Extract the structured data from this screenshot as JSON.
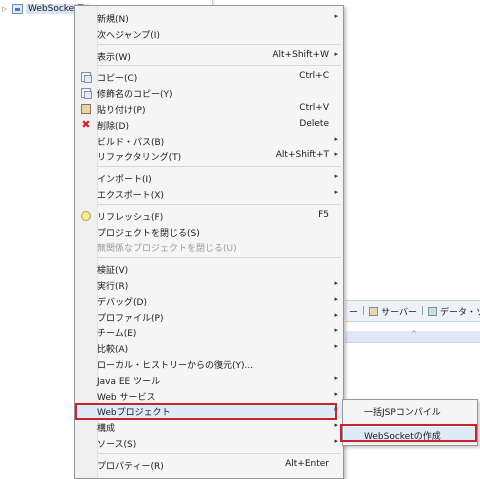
{
  "tree": {
    "project_label": "WebSocketTe"
  },
  "bottom_tabs": [
    {
      "label": "ー",
      "icon": ""
    },
    {
      "label": "サーバー",
      "icon": "server-icon"
    },
    {
      "label": "データ・ソー",
      "icon": "data-source-icon"
    }
  ],
  "menu": {
    "items": [
      {
        "label": "新規(N)",
        "shortcut": "",
        "submenu": true,
        "icon": "",
        "disabled": false
      },
      {
        "label": "次へジャンプ(I)",
        "shortcut": "",
        "submenu": false,
        "icon": "",
        "disabled": false
      },
      {
        "sep": true
      },
      {
        "label": "表示(W)",
        "shortcut": "Alt+Shift+W",
        "submenu": true,
        "icon": "",
        "disabled": false
      },
      {
        "sep": true
      },
      {
        "label": "コピー(C)",
        "shortcut": "Ctrl+C",
        "submenu": false,
        "icon": "copy-icon",
        "disabled": false
      },
      {
        "label": "修飾名のコピー(Y)",
        "shortcut": "",
        "submenu": false,
        "icon": "copy-qualified-icon",
        "disabled": false
      },
      {
        "label": "貼り付け(P)",
        "shortcut": "Ctrl+V",
        "submenu": false,
        "icon": "paste-icon",
        "disabled": false
      },
      {
        "label": "削除(D)",
        "shortcut": "Delete",
        "submenu": false,
        "icon": "delete-icon",
        "disabled": false
      },
      {
        "label": "ビルド・パス(B)",
        "shortcut": "",
        "submenu": true,
        "icon": "",
        "disabled": false
      },
      {
        "label": "リファクタリング(T)",
        "shortcut": "Alt+Shift+T",
        "submenu": true,
        "icon": "",
        "disabled": false
      },
      {
        "sep": true
      },
      {
        "label": "インポート(I)",
        "shortcut": "",
        "submenu": true,
        "icon": "",
        "disabled": false
      },
      {
        "label": "エクスポート(X)",
        "shortcut": "",
        "submenu": true,
        "icon": "",
        "disabled": false
      },
      {
        "sep": true
      },
      {
        "label": "リフレッシュ(F)",
        "shortcut": "F5",
        "submenu": false,
        "icon": "refresh-icon",
        "disabled": false
      },
      {
        "label": "プロジェクトを閉じる(S)",
        "shortcut": "",
        "submenu": false,
        "icon": "",
        "disabled": false
      },
      {
        "label": "無関係なプロジェクトを閉じる(U)",
        "shortcut": "",
        "submenu": false,
        "icon": "",
        "disabled": true
      },
      {
        "sep": true
      },
      {
        "label": "検証(V)",
        "shortcut": "",
        "submenu": false,
        "icon": "",
        "disabled": false
      },
      {
        "label": "実行(R)",
        "shortcut": "",
        "submenu": true,
        "icon": "",
        "disabled": false
      },
      {
        "label": "デバッグ(D)",
        "shortcut": "",
        "submenu": true,
        "icon": "",
        "disabled": false
      },
      {
        "label": "プロファイル(P)",
        "shortcut": "",
        "submenu": true,
        "icon": "",
        "disabled": false
      },
      {
        "label": "チーム(E)",
        "shortcut": "",
        "submenu": true,
        "icon": "",
        "disabled": false
      },
      {
        "label": "比較(A)",
        "shortcut": "",
        "submenu": true,
        "icon": "",
        "disabled": false
      },
      {
        "label": "ローカル・ヒストリーからの復元(Y)...",
        "shortcut": "",
        "submenu": false,
        "icon": "",
        "disabled": false
      },
      {
        "label": "Java EE ツール",
        "shortcut": "",
        "submenu": true,
        "icon": "",
        "disabled": false
      },
      {
        "label": "Web サービス",
        "shortcut": "",
        "submenu": true,
        "icon": "",
        "disabled": false
      },
      {
        "label": "Webプロジェクト",
        "shortcut": "",
        "submenu": true,
        "icon": "",
        "disabled": false,
        "highlighted": true
      },
      {
        "label": "構成",
        "shortcut": "",
        "submenu": true,
        "icon": "",
        "disabled": false
      },
      {
        "label": "ソース(S)",
        "shortcut": "",
        "submenu": true,
        "icon": "",
        "disabled": false
      },
      {
        "sep": true
      },
      {
        "label": "プロパティー(R)",
        "shortcut": "Alt+Enter",
        "submenu": false,
        "icon": "",
        "disabled": false
      }
    ]
  },
  "submenu": {
    "items": [
      {
        "label": "一括JSPコンパイル",
        "highlighted": false
      },
      {
        "label": "WebSocketの作成",
        "highlighted": true
      }
    ]
  }
}
